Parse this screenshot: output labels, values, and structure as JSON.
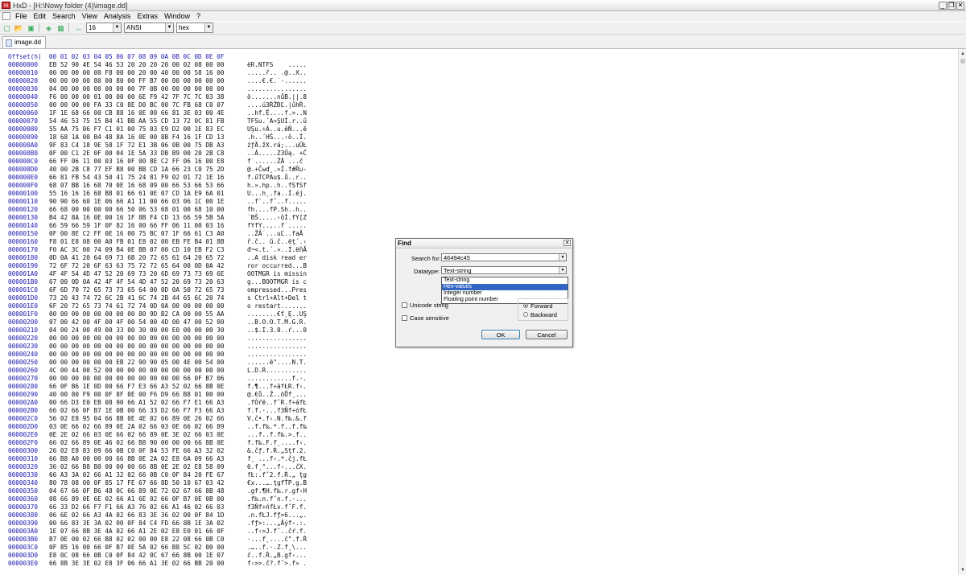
{
  "window": {
    "title": "HxD - [H:\\Nowy folder (4)\\image.dd]"
  },
  "menu": [
    "File",
    "Edit",
    "Search",
    "View",
    "Analysis",
    "Extras",
    "Window",
    "?"
  ],
  "toolbar": {
    "bytes_per_row": "16",
    "charset": "ANSI",
    "offset_base": "hex"
  },
  "tab": {
    "label": "image.dd"
  },
  "editor": {
    "header": "Offset(h)  00 01 02 03 04 05 06 07 08 09 0A 0B 0C 0D 0E 0F",
    "rows": [
      {
        "o": "00000000",
        "h": "EB 52 90 4E 54 46 53 20 20 20 20 00 02 08 00 00",
        "a": "ëR.NTFS    ....."
      },
      {
        "o": "00000010",
        "h": "00 00 00 00 00 F8 00 00 20 00 40 00 00 58 16 00",
        "a": ".....ř.. .@..X.."
      },
      {
        "o": "00000020",
        "h": "00 00 00 00 80 00 80 00 FF B7 00 00 00 00 00 00",
        "a": "....€.€.˙·......"
      },
      {
        "o": "00000030",
        "h": "04 00 00 00 00 00 00 00 7F 0B 00 00 00 00 00 00",
        "a": "................"
      },
      {
        "o": "00000040",
        "h": "F6 00 00 00 01 00 00 00 6E F9 42 7F 7C 7C 03 38",
        "a": "ö.......nůB.||.8"
      },
      {
        "o": "00000050",
        "h": "00 00 00 00 FA 33 C0 8E D0 BC 00 7C FB 68 C0 07",
        "a": "....ú3ŔŽĐĽ.|űhŔ."
      },
      {
        "o": "00000060",
        "h": "1F 1E 68 66 00 CB 88 16 0E 00 66 81 3E 03 00 4E",
        "a": "..hf.Ë....f.>..N"
      },
      {
        "o": "00000070",
        "h": "54 46 53 75 15 B4 41 BB AA 55 CD 13 72 0C 81 FB",
        "a": "TFSu.´A»ŞUÍ.r..ű"
      },
      {
        "o": "00000080",
        "h": "55 AA 75 06 F7 C1 01 00 75 03 E9 D2 00 1E 83 EC",
        "a": "UŞu.÷Á..u.éŇ...ě"
      },
      {
        "o": "00000090",
        "h": "18 68 1A 00 B4 48 8A 16 0E 00 8B F4 16 1F CD 13",
        "a": ".h..´HŠ...‹ô..Í."
      },
      {
        "o": "000000A0",
        "h": "9F 83 C4 18 9E 58 1F 72 E1 3B 06 0B 00 75 DB A3",
        "a": "źƒÄ.žX.rá;...uŰŁ"
      },
      {
        "o": "000000B0",
        "h": "0F 00 C1 2E 0F 00 04 1E 5A 33 DB B9 00 20 2B C8",
        "a": "..Á.....Z3Űą. +Č"
      },
      {
        "o": "000000C0",
        "h": "66 FF 06 11 00 03 16 0F 00 8E C2 FF 06 16 00 E8",
        "a": "f˙......ŽÂ˙...č"
      },
      {
        "o": "000000D0",
        "h": "40 00 2B C8 77 EF B8 00 BB CD 1A 66 23 C0 75 2D",
        "a": "@.+Čwď¸.»Í.f#Ŕu-"
      },
      {
        "o": "000000E0",
        "h": "66 81 FB 54 43 50 41 75 24 81 F9 02 01 72 1E 16",
        "a": "f.űTCPAu$.ů..r.."
      },
      {
        "o": "000000F0",
        "h": "68 07 BB 16 68 70 0E 16 68 09 00 66 53 66 53 66",
        "a": "h.».hp..h..fSfSf"
      },
      {
        "o": "00000100",
        "h": "55 16 16 16 68 B8 01 66 61 0E 07 CD 1A E9 6A 01",
        "a": "U...h¸.fa..Í.éj."
      },
      {
        "o": "00000110",
        "h": "90 90 66 60 1E 06 66 A1 11 00 66 03 06 1C 00 1E",
        "a": "..f`..fˇ..f....."
      },
      {
        "o": "00000120",
        "h": "66 68 00 00 00 00 66 50 06 53 68 01 00 68 10 00",
        "a": "fh....fP.Sh..h.."
      },
      {
        "o": "00000130",
        "h": "B4 42 8A 16 0E 00 16 1F 8B F4 CD 13 66 59 5B 5A",
        "a": "´BŠ.....‹ôÍ.fY[Z"
      },
      {
        "o": "00000140",
        "h": "66 59 66 59 1F 0F 82 16 00 66 FF 06 11 00 03 16",
        "a": "fYfY..‚..f˙....."
      },
      {
        "o": "00000150",
        "h": "0F 00 8E C2 FF 0E 16 00 75 BC 07 1F 66 61 C3 A0",
        "a": "..ŽÂ˙...uĽ..faĂ "
      },
      {
        "o": "00000160",
        "h": "F8 01 E8 08 00 A0 FB 01 E8 02 00 EB FE B4 01 8B",
        "a": "ř.č.. ű.č..ëţ´.‹"
      },
      {
        "o": "00000170",
        "h": "F0 AC 3C 00 74 09 B4 0E BB 07 00 CD 10 EB F2 C3",
        "a": "đ¬<.t.´.»..Í.ëňĂ"
      },
      {
        "o": "00000180",
        "h": "0D 0A 41 20 64 69 73 6B 20 72 65 61 64 20 65 72",
        "a": "..A disk read er"
      },
      {
        "o": "00000190",
        "h": "72 6F 72 20 6F 63 63 75 72 72 65 64 00 0D 0A 42",
        "a": "ror occurred...B"
      },
      {
        "o": "000001A0",
        "h": "4F 4F 54 4D 47 52 20 69 73 20 6D 69 73 73 69 6E",
        "a": "OOTMGR is missin"
      },
      {
        "o": "000001B0",
        "h": "67 00 0D 0A 42 4F 4F 54 4D 47 52 20 69 73 20 63",
        "a": "g...BOOTMGR is c"
      },
      {
        "o": "000001C0",
        "h": "6F 6D 70 72 65 73 73 65 64 00 0D 0A 50 72 65 73",
        "a": "ompressed...Pres"
      },
      {
        "o": "000001D0",
        "h": "73 20 43 74 72 6C 2B 41 6C 74 2B 44 65 6C 20 74",
        "a": "s Ctrl+Alt+Del t"
      },
      {
        "o": "000001E0",
        "h": "6F 20 72 65 73 74 61 72 74 0D 0A 00 00 00 00 00",
        "a": "o restart......."
      },
      {
        "o": "000001F0",
        "h": "00 00 00 00 00 00 00 00 80 9D B2 CA 00 00 55 AA",
        "a": "........€ť˛Ę..UŞ"
      },
      {
        "o": "00000200",
        "h": "07 00 42 00 4F 00 4F 00 54 00 4D 00 47 00 52 00",
        "a": "..B.O.O.T.M.G.R."
      },
      {
        "o": "00000210",
        "h": "04 00 24 00 49 00 33 00 30 00 00 E0 00 00 00 30",
        "a": "..$.I.3.0..ŕ...0"
      },
      {
        "o": "00000220",
        "h": "00 00 00 00 00 00 00 00 00 00 00 00 00 00 00 00",
        "a": "................"
      },
      {
        "o": "00000230",
        "h": "00 00 00 00 00 00 00 00 00 00 00 00 00 00 00 00",
        "a": "................"
      },
      {
        "o": "00000240",
        "h": "00 00 00 00 00 00 00 00 00 00 00 00 00 00 00 00",
        "a": "................"
      },
      {
        "o": "00000250",
        "h": "00 00 00 00 00 00 EB 22 90 90 05 00 4E 00 54 00",
        "a": "......ë\"....N.T."
      },
      {
        "o": "00000260",
        "h": "4C 00 44 00 52 00 00 00 00 00 00 00 00 00 00 00",
        "a": "L.D.R..........."
      },
      {
        "o": "00000270",
        "h": "00 00 00 00 00 00 00 00 00 00 00 00 66 0F B7 06",
        "a": "............f.·."
      },
      {
        "o": "00000280",
        "h": "66 0F B6 1E 0D 00 66 F7 E3 66 A3 52 02 66 8B 0E",
        "a": "f.¶...f÷ăfŁR.f‹."
      },
      {
        "o": "00000290",
        "h": "40 00 80 F9 00 0F 8F 0E 00 F6 D9 66 B8 01 00 00",
        "a": "@.€ů..Ź..öŮf¸..."
      },
      {
        "o": "000002A0",
        "h": "00 66 D3 E0 EB 08 90 66 A1 52 02 66 F7 E1 66 A3",
        "a": ".fÓŕë..fˇR.f÷áfŁ"
      },
      {
        "o": "000002B0",
        "h": "66 02 66 0F B7 1E 0B 00 66 33 D2 66 F7 F3 66 A3",
        "a": "f.f.·...f3Ňf÷ófŁ"
      },
      {
        "o": "000002C0",
        "h": "56 02 E8 95 04 66 8B 0E 4E 02 66 89 0E 26 02 66",
        "a": "V.č•.f‹.N.f‰.&.f"
      },
      {
        "o": "000002D0",
        "h": "03 0E 66 02 66 89 0E 2A 02 66 03 0E 66 02 66 89",
        "a": "..f.f‰.*.f..f.f‰"
      },
      {
        "o": "000002E0",
        "h": "0E 2E 02 66 03 0E 66 02 66 89 0E 3E 02 66 03 0E",
        "a": "...f..f.f‰.>.f.."
      },
      {
        "o": "000002F0",
        "h": "66 02 66 89 0E 46 02 66 B8 90 00 00 00 66 8B 0E",
        "a": "f.f‰.F.f¸....f‹."
      },
      {
        "o": "00000300",
        "h": "26 02 E8 83 09 66 0B C0 0F 84 53 FE 66 A3 32 02",
        "a": "&.čƒ.f.Ŕ.„Sţf.2."
      },
      {
        "o": "00000310",
        "h": "66 B8 A0 00 00 00 66 8B 0E 2A 02 E8 6A 09 66 A3",
        "a": "f¸ ...f‹.*.čj.fŁ"
      },
      {
        "o": "00000320",
        "h": "36 02 66 B8 B0 00 00 00 66 8B 0E 2E 02 E8 58 09",
        "a": "6.f¸°...f‹...čX."
      },
      {
        "o": "00000330",
        "h": "66 A3 3A 02 66 A1 32 02 66 0B C0 0F 84 20 FE 67",
        "a": "fŁ:.fˇ2.f.Ŕ.„ ţg"
      },
      {
        "o": "00000340",
        "h": "80 78 08 00 0F 85 17 FE 67 66 8D 50 10 67 03 42",
        "a": "€x...….ţgfŤP.g.B"
      },
      {
        "o": "00000350",
        "h": "04 67 66 0F B6 48 0C 66 89 0E 72 02 67 66 8B 48",
        "a": ".gf.¶H.f‰.r.gf‹H"
      },
      {
        "o": "00000360",
        "h": "08 66 89 0E 6E 02 66 A1 6E 02 66 0F B7 0E 0B 00",
        "a": ".f‰.n.fˇn.f.·..."
      },
      {
        "o": "00000370",
        "h": "66 33 D2 66 F7 F1 66 A3 76 02 66 A1 46 02 66 03",
        "a": "f3Ňf÷ńfŁv.fˇF.f."
      },
      {
        "o": "00000380",
        "h": "06 6E 02 66 A3 4A 02 66 83 3E 36 02 00 0F 84 1D",
        "a": ".n.fŁJ.fƒ>6...„."
      },
      {
        "o": "00000390",
        "h": "00 66 83 3E 3A 02 00 0F 84 C4 FD 66 8B 1E 3A 02",
        "a": ".fƒ>:...„Äýf‹.:."
      },
      {
        "o": "000003A0",
        "h": "1E 07 66 8B 3E 4A 02 66 A1 2E 02 E8 E0 01 66 0F",
        "a": "..f‹>J.fˇ..čŕ.f."
      },
      {
        "o": "000003B0",
        "h": "B7 0E 00 02 66 B8 02 02 00 00 E8 22 08 66 0B C0",
        "a": "·...f¸....č\".f.Ŕ"
      },
      {
        "o": "000003C0",
        "h": "0F 85 16 00 66 0F B7 0E 5A 02 66 B8 5C 02 00 00",
        "a": ".…..f.·.Z.f¸\\..."
      },
      {
        "o": "000003D0",
        "h": "E8 0C 08 66 0B C0 0F 84 42 0C 67 66 8B 00 1E 07",
        "a": "č..f.Ŕ.„B.gf‹..."
      },
      {
        "o": "000003E0",
        "h": "66 8B 3E 3E 02 E8 3F 06 66 A1 3E 02 66 BB 20 00",
        "a": "f‹>>.č?.fˇ>.f» ."
      }
    ]
  },
  "find_dialog": {
    "title": "Find",
    "search_label": "Search for:",
    "search_value": "46494c45",
    "datatype_label": "Datatype:",
    "datatype_value": "Text-string",
    "datatype_options": [
      "Text-string",
      "Hex-values",
      "Integer number",
      "Floating point number"
    ],
    "highlighted_option": "Hex-values",
    "unicode_label": "Unicode string",
    "case_label": "Case sensitive",
    "forward_label": "Forward",
    "backward_label": "Backward",
    "ok_label": "OK",
    "cancel_label": "Cancel"
  }
}
